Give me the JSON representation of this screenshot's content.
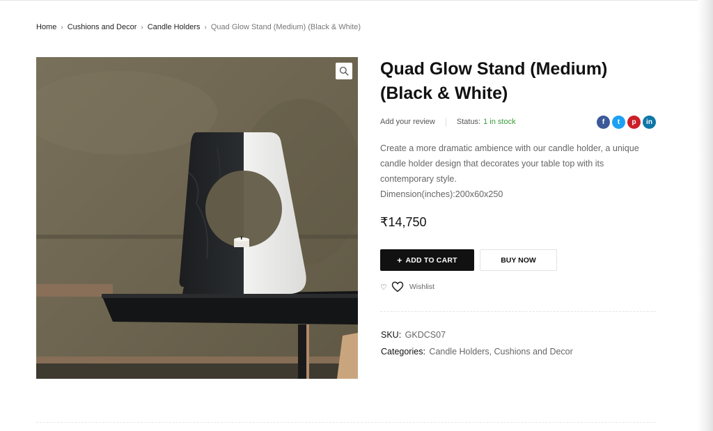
{
  "breadcrumb": {
    "items": [
      "Home",
      "Cushions and Decor",
      "Candle Holders"
    ],
    "current": "Quad Glow Stand (Medium) (Black & White)",
    "separator": "›"
  },
  "product": {
    "title_line1": "Quad Glow Stand (Medium)",
    "title_line2": "(Black & White)",
    "review_link": "Add your review",
    "status_label": "Status:",
    "status_value": "1 in stock",
    "description": "Create a more dramatic ambience with our candle holder, a unique candle holder design that decorates your table top with its contemporary style.",
    "dimension": "Dimension(inches):200x60x250",
    "price": "₹14,750",
    "add_to_cart_icon": "+",
    "add_to_cart_label": "ADD TO CART",
    "buy_now_label": "BUY NOW",
    "wishlist_label": "Wishlist",
    "sku_label": "SKU:",
    "sku_value": "GKDCS07",
    "categories_label": "Categories:",
    "categories_value": "Candle Holders, Cushions and Decor"
  },
  "share": {
    "icons": [
      "facebook-icon",
      "twitter-icon",
      "pinterest-icon",
      "linkedin-icon"
    ],
    "glyphs": [
      "f",
      "t",
      "p",
      "in"
    ]
  },
  "image": {
    "icon": "zoom-icon"
  },
  "colors": {
    "status_green": "#3a9a3a",
    "cart_button_bg": "#111111",
    "facebook": "#3b5998",
    "twitter": "#1da1f2",
    "pinterest": "#cb2027",
    "linkedin": "#0e76a8"
  }
}
